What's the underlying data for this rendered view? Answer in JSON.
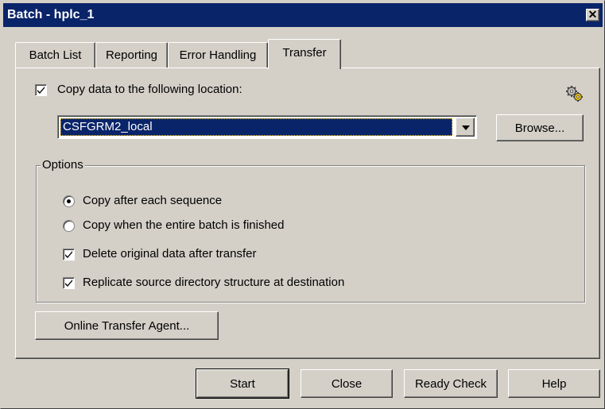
{
  "window": {
    "title": "Batch - hplc_1",
    "close_glyph": "✕"
  },
  "tabs": [
    {
      "label": "Batch List",
      "active": false
    },
    {
      "label": "Reporting",
      "active": false
    },
    {
      "label": "Error Handling",
      "active": false
    },
    {
      "label": "Transfer",
      "active": true
    }
  ],
  "transfer": {
    "copy_data_label": "Copy data to the following location:",
    "copy_data_checked": true,
    "location_value": "CSFGRM2_local",
    "browse_label": "Browse...",
    "settings_icon": "gears-icon",
    "options": {
      "title": "Options",
      "radio_after_each": "Copy after each sequence",
      "radio_after_each_selected": true,
      "radio_when_finished": "Copy when the entire batch is finished",
      "radio_when_finished_selected": false,
      "delete_original_label": "Delete original data after transfer",
      "delete_original_checked": true,
      "replicate_label": "Replicate source directory structure at destination",
      "replicate_checked": true
    },
    "online_agent_label": "Online Transfer Agent..."
  },
  "footer": {
    "start_label": "Start",
    "close_label": "Close",
    "ready_check_label": "Ready Check",
    "help_label": "Help"
  },
  "colors": {
    "titlebar": "#0a246a",
    "face": "#d4d0c8",
    "selection": "#0a246a"
  }
}
